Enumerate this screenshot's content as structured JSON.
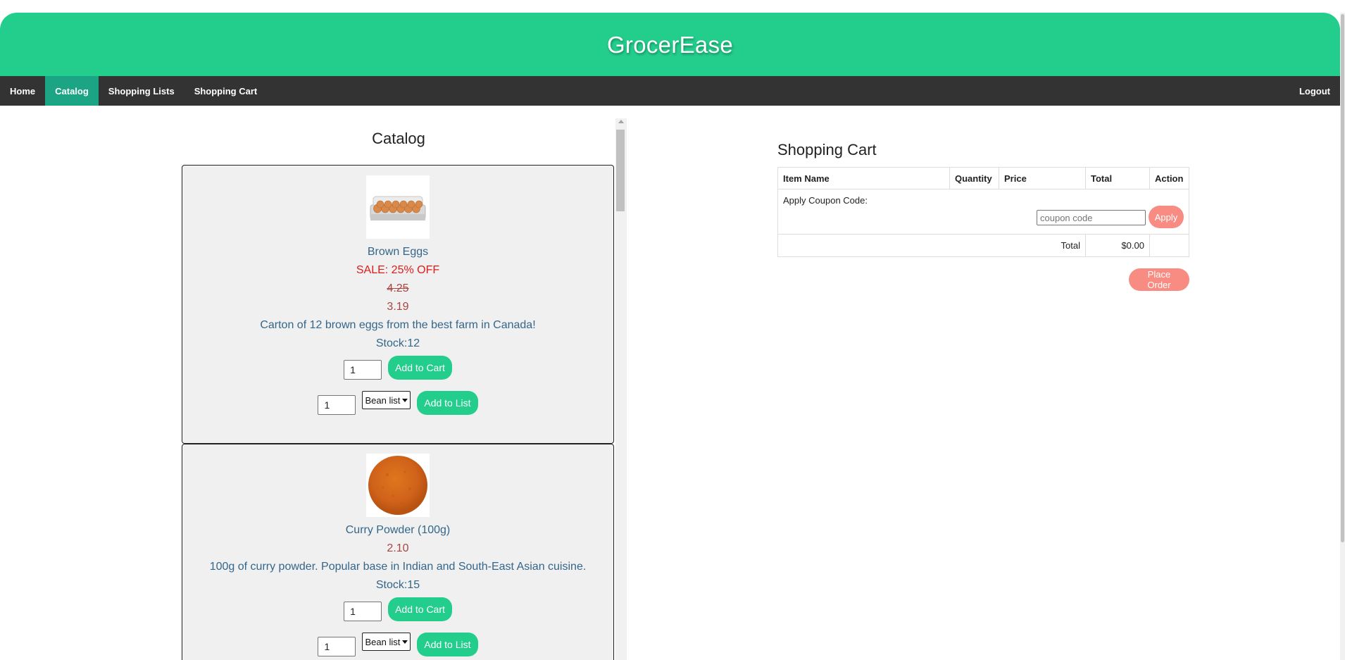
{
  "app": {
    "title": "GrocerEase"
  },
  "nav": {
    "items": [
      {
        "label": "Home",
        "active": false
      },
      {
        "label": "Catalog",
        "active": true
      },
      {
        "label": "Shopping Lists",
        "active": false
      },
      {
        "label": "Shopping Cart",
        "active": false
      }
    ],
    "logout": "Logout"
  },
  "catalog": {
    "title": "Catalog",
    "products": [
      {
        "name": "Brown Eggs",
        "sale": "SALE: 25% OFF",
        "old_price": "4.25",
        "price": "3.19",
        "description": "Carton of 12 brown eggs from the best farm in Canada!",
        "stock": "Stock:12",
        "cart_qty": "1",
        "add_to_cart": "Add to Cart",
        "list_qty": "1",
        "list_selected": "Bean list",
        "add_to_list": "Add to List",
        "icon": "egg-carton-icon"
      },
      {
        "name": "Curry Powder (100g)",
        "price": "2.10",
        "description": "100g of curry powder. Popular base in Indian and South-East Asian cuisine.",
        "stock": "Stock:15",
        "cart_qty": "1",
        "add_to_cart": "Add to Cart",
        "list_qty": "1",
        "list_selected": "Bean list",
        "add_to_list": "Add to List",
        "icon": "curry-powder-icon"
      }
    ]
  },
  "cart": {
    "title": "Shopping Cart",
    "columns": [
      "Item Name",
      "Quantity",
      "Price",
      "Total",
      "Action"
    ],
    "coupon_label": "Apply Coupon Code:",
    "coupon_placeholder": "coupon code",
    "apply_label": "Apply",
    "total_label": "Total",
    "total_value": "$0.00",
    "place_order": "Place Order"
  },
  "colors": {
    "header": "#23cd8c",
    "nav": "#333333",
    "nav_active": "#1ca585",
    "button_green": "#23cd8c",
    "button_coral": "#f88b82",
    "sale": "#e01b1b",
    "price": "#a94442",
    "product_text": "#33668a"
  }
}
